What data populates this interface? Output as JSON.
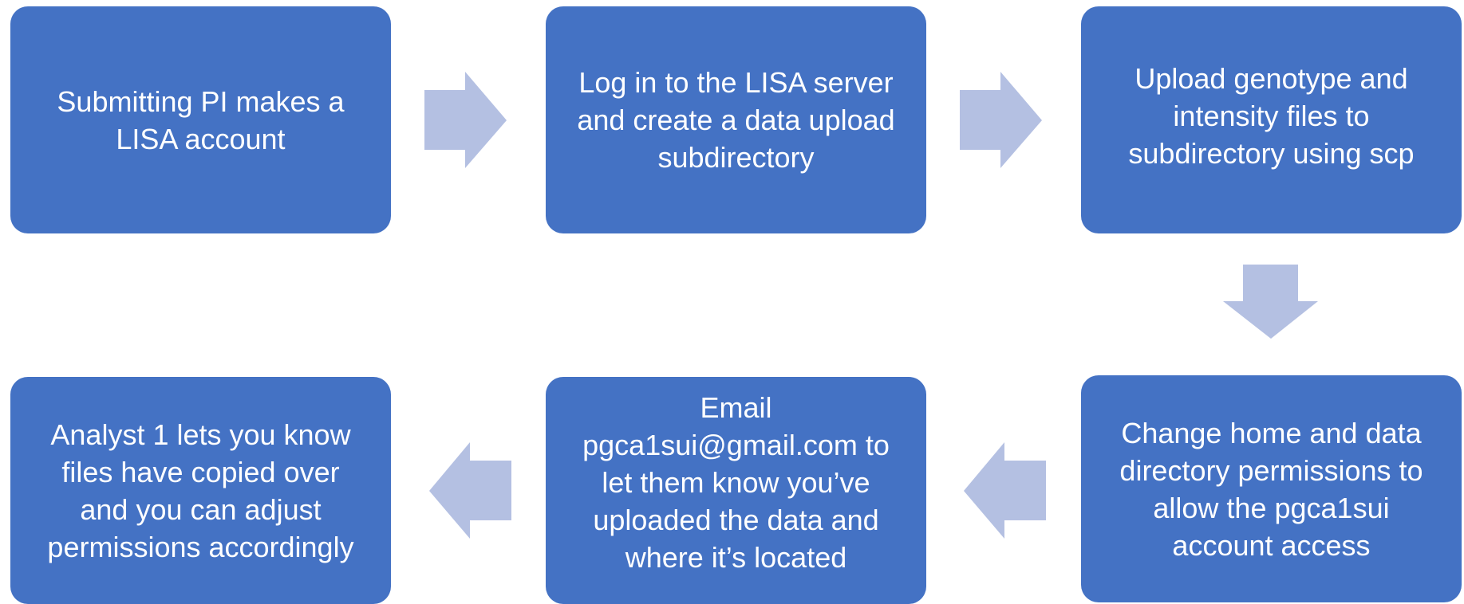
{
  "colors": {
    "box_fill": "#4472c4",
    "box_text": "#ffffff",
    "arrow_fill": "#b4c0e2",
    "background": "#ffffff"
  },
  "steps": [
    {
      "text": "Submitting PI makes a\nLISA account"
    },
    {
      "text": "Log in to the LISA server\nand create a data upload\nsubdirectory"
    },
    {
      "text": "Upload genotype and\nintensity files to\nsubdirectory using scp"
    },
    {
      "text": "Change home and data\ndirectory permissions to\nallow the pgca1sui\naccount access"
    },
    {
      "text": "Email\npgca1sui@gmail.com to\nlet them know you’ve\nuploaded the data and\nwhere it’s located"
    },
    {
      "text": "Analyst 1 lets you know\nfiles have copied over\nand you can adjust\npermissions accordingly"
    }
  ],
  "connectors": [
    {
      "from": 1,
      "to": 2,
      "direction": "right"
    },
    {
      "from": 2,
      "to": 3,
      "direction": "right"
    },
    {
      "from": 3,
      "to": 4,
      "direction": "down"
    },
    {
      "from": 4,
      "to": 5,
      "direction": "left"
    },
    {
      "from": 5,
      "to": 6,
      "direction": "left"
    }
  ]
}
